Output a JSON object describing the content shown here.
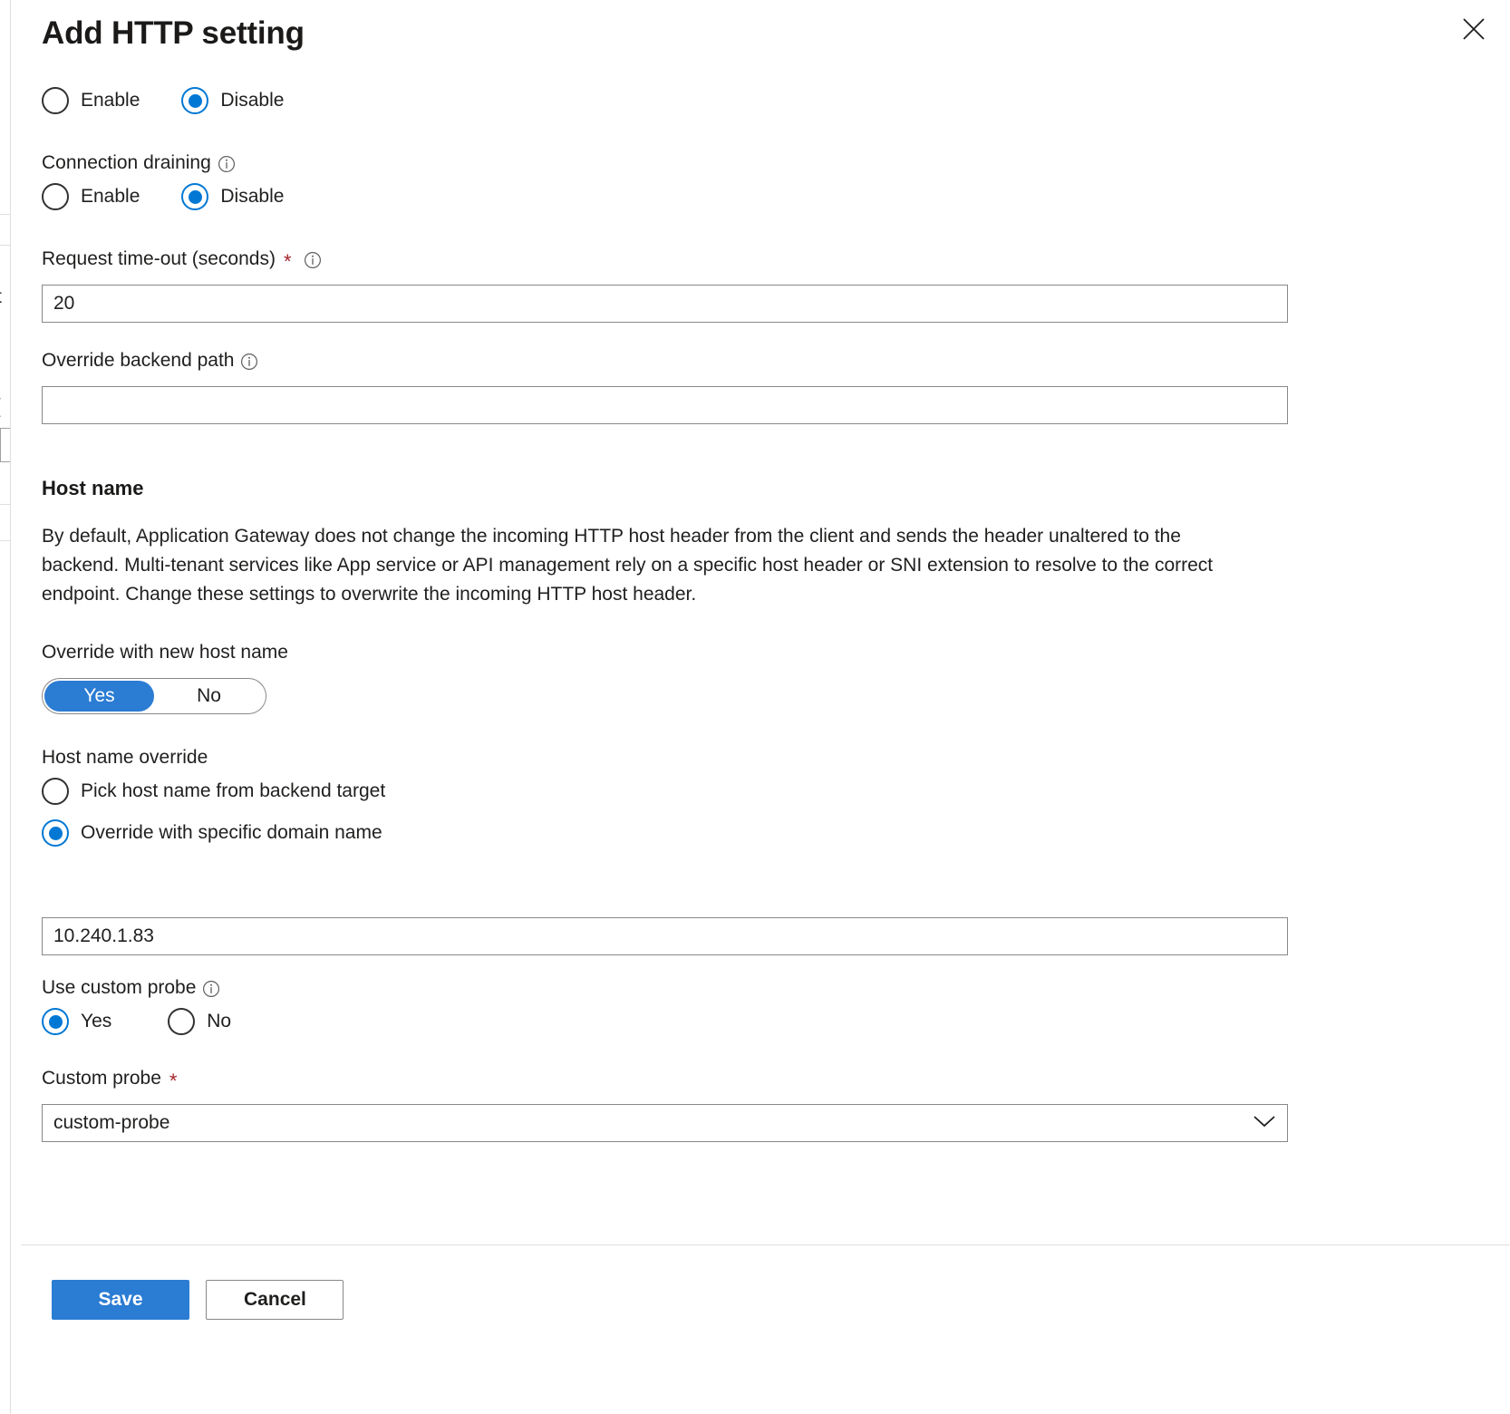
{
  "dialog": {
    "title": "Add HTTP setting",
    "close_label": "Close"
  },
  "background_blade": {
    "fragments": [
      "t",
      "("
    ]
  },
  "cookie_affinity": {
    "enable_label": "Enable",
    "disable_label": "Disable",
    "selected": "Disable"
  },
  "connection_draining": {
    "label": "Connection draining",
    "info_icon": "info-icon",
    "enable_label": "Enable",
    "disable_label": "Disable",
    "selected": "Disable"
  },
  "request_timeout": {
    "label": "Request time-out (seconds)",
    "required_marker": "*",
    "info_icon": "info-icon",
    "value": "20",
    "placeholder": ""
  },
  "override_backend_path": {
    "label": "Override backend path",
    "info_icon": "info-icon",
    "value": "",
    "placeholder": ""
  },
  "host_name": {
    "heading": "Host name",
    "description": "By default, Application Gateway does not change the incoming HTTP host header from the client and sends the header unaltered to the backend. Multi-tenant services like App service or API management rely on a specific host header or SNI extension to resolve to the correct endpoint. Change these settings to overwrite the incoming HTTP host header.",
    "override_toggle": {
      "label": "Override with new host name",
      "yes_label": "Yes",
      "no_label": "No",
      "selected": "Yes"
    },
    "override_mode": {
      "label": "Host name override",
      "options": [
        "Pick host name from backend target",
        "Override with specific domain name"
      ],
      "selected": "Override with specific domain name"
    },
    "domain_input": {
      "value": "10.240.1.83",
      "placeholder": ""
    }
  },
  "use_custom_probe": {
    "label": "Use custom probe",
    "info_icon": "info-icon",
    "yes_label": "Yes",
    "no_label": "No",
    "selected": "Yes"
  },
  "custom_probe": {
    "label": "Custom probe",
    "required_marker": "*",
    "value": "custom-probe",
    "chevron_icon": "chevron-down-icon"
  },
  "footer": {
    "save_label": "Save",
    "cancel_label": "Cancel"
  },
  "colors": {
    "accent": "#0078d4",
    "toggle_blue": "#2b7cd3",
    "required_red": "#a4262c",
    "border": "#8a8886"
  }
}
